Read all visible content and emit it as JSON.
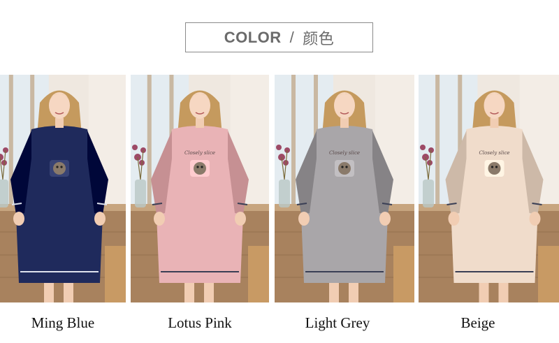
{
  "header": {
    "en": "COLOR",
    "separator": "/",
    "zh": "颜色"
  },
  "variants": [
    {
      "label": "Ming Blue",
      "color": "#1f2a5c"
    },
    {
      "label": "Lotus Pink",
      "color": "#e9b3b6"
    },
    {
      "label": "Light Grey",
      "color": "#a9a6a9"
    },
    {
      "label": "Beige",
      "color": "#f0dccb"
    }
  ],
  "print_text": "Closely slice"
}
